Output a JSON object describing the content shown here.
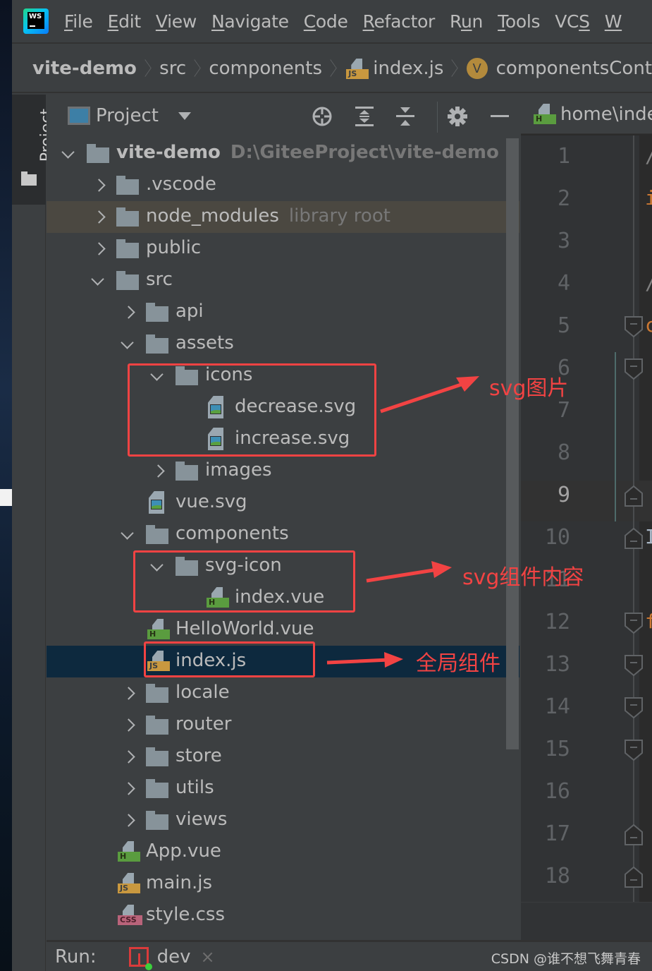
{
  "menu": {
    "app_logo": "webstorm-logo-icon",
    "items": [
      {
        "label": "File",
        "mnemonic": "F"
      },
      {
        "label": "Edit",
        "mnemonic": "E"
      },
      {
        "label": "View",
        "mnemonic": "V"
      },
      {
        "label": "Navigate",
        "mnemonic": "N"
      },
      {
        "label": "Code",
        "mnemonic": "C"
      },
      {
        "label": "Refactor",
        "mnemonic": "R"
      },
      {
        "label": "Run",
        "mnemonic": "u"
      },
      {
        "label": "Tools",
        "mnemonic": "T"
      },
      {
        "label": "VCS",
        "mnemonic": "S"
      },
      {
        "label": "W",
        "mnemonic": "W"
      }
    ]
  },
  "breadcrumb": [
    {
      "label": "vite-demo",
      "icon": null
    },
    {
      "label": "src",
      "icon": null
    },
    {
      "label": "components",
      "icon": null
    },
    {
      "label": "index.js",
      "icon": "js-file-icon"
    },
    {
      "label": "componentsCont",
      "icon": "variable-icon",
      "badge": "V"
    }
  ],
  "tool_stripe": {
    "project_tab": "Project"
  },
  "project_panel": {
    "title": "Project",
    "toolbar": [
      "locate-icon",
      "expand-all-icon",
      "collapse-all-icon",
      "gear-icon",
      "hide-icon"
    ],
    "tree": [
      {
        "name": "vite-demo",
        "hint": "D:\\GiteeProject\\vite-demo",
        "type": "folder",
        "depth": 0,
        "state": "expanded",
        "bold": true
      },
      {
        "name": ".vscode",
        "type": "folder",
        "depth": 1,
        "state": "collapsed"
      },
      {
        "name": "node_modules",
        "hint": "library root",
        "type": "folder",
        "depth": 1,
        "state": "collapsed",
        "library": true
      },
      {
        "name": "public",
        "type": "folder",
        "depth": 1,
        "state": "collapsed"
      },
      {
        "name": "src",
        "type": "folder",
        "depth": 1,
        "state": "expanded"
      },
      {
        "name": "api",
        "type": "folder",
        "depth": 2,
        "state": "collapsed"
      },
      {
        "name": "assets",
        "type": "folder",
        "depth": 2,
        "state": "expanded"
      },
      {
        "name": "icons",
        "type": "folder",
        "depth": 3,
        "state": "expanded"
      },
      {
        "name": "decrease.svg",
        "type": "image",
        "depth": 4
      },
      {
        "name": "increase.svg",
        "type": "image",
        "depth": 4
      },
      {
        "name": "images",
        "type": "folder",
        "depth": 3,
        "state": "collapsed"
      },
      {
        "name": "vue.svg",
        "type": "image",
        "depth": 3,
        "leaf": true
      },
      {
        "name": "components",
        "type": "folder",
        "depth": 2,
        "state": "expanded"
      },
      {
        "name": "svg-icon",
        "type": "folder",
        "depth": 3,
        "state": "expanded"
      },
      {
        "name": "index.vue",
        "type": "vue",
        "depth": 4
      },
      {
        "name": "HelloWorld.vue",
        "type": "vue",
        "depth": 3,
        "leaf": true
      },
      {
        "name": "index.js",
        "type": "js",
        "depth": 3,
        "leaf": true,
        "selected": true
      },
      {
        "name": "locale",
        "type": "folder",
        "depth": 2,
        "state": "collapsed"
      },
      {
        "name": "router",
        "type": "folder",
        "depth": 2,
        "state": "collapsed"
      },
      {
        "name": "store",
        "type": "folder",
        "depth": 2,
        "state": "collapsed"
      },
      {
        "name": "utils",
        "type": "folder",
        "depth": 2,
        "state": "collapsed"
      },
      {
        "name": "views",
        "type": "folder",
        "depth": 2,
        "state": "collapsed"
      },
      {
        "name": "App.vue",
        "type": "vue",
        "depth": 2,
        "leaf": true
      },
      {
        "name": "main.js",
        "type": "js",
        "depth": 2,
        "leaf": true
      },
      {
        "name": "style.css",
        "type": "css",
        "depth": 2,
        "leaf": true
      }
    ]
  },
  "file_tags": {
    "js": "JS",
    "vue": "H",
    "css": "CSS"
  },
  "annotations": [
    {
      "text": "svg图片",
      "target": "icons"
    },
    {
      "text": "svg组件内容",
      "target": "svg-icon"
    },
    {
      "text": "全局组件",
      "target": "index.js"
    }
  ],
  "editor": {
    "tab_label": "home\\inde",
    "tab_icon_tag": "H",
    "line_numbers": [
      "1",
      "2",
      "3",
      "4",
      "5",
      "6",
      "7",
      "8",
      "9",
      "10",
      "11",
      "12",
      "13",
      "14",
      "15",
      "16",
      "17",
      "18"
    ],
    "current_line": "9",
    "code_glyphs": [
      {
        "line": 1,
        "char": "/",
        "color": "#808080"
      },
      {
        "line": 2,
        "char": "i",
        "color": "#cc7832"
      },
      {
        "line": 4,
        "char": "/",
        "color": "#808080"
      },
      {
        "line": 5,
        "char": "c",
        "color": "#cc7832"
      },
      {
        "line": 10,
        "char": "I",
        "color": "#a9b7c6"
      },
      {
        "line": 12,
        "char": "f",
        "color": "#cc7832"
      }
    ],
    "fold_markers": [
      {
        "line": 5,
        "kind": "open"
      },
      {
        "line": 6,
        "kind": "open"
      },
      {
        "line": 9,
        "kind": "close"
      },
      {
        "line": 10,
        "kind": "close"
      },
      {
        "line": 12,
        "kind": "open"
      },
      {
        "line": 13,
        "kind": "open"
      },
      {
        "line": 14,
        "kind": "open"
      },
      {
        "line": 15,
        "kind": "open"
      },
      {
        "line": 17,
        "kind": "close"
      },
      {
        "line": 18,
        "kind": "close"
      }
    ]
  },
  "runbar": {
    "label": "Run:",
    "config": "dev",
    "close": "×"
  },
  "watermark": "CSDN @谁不想飞舞青春"
}
